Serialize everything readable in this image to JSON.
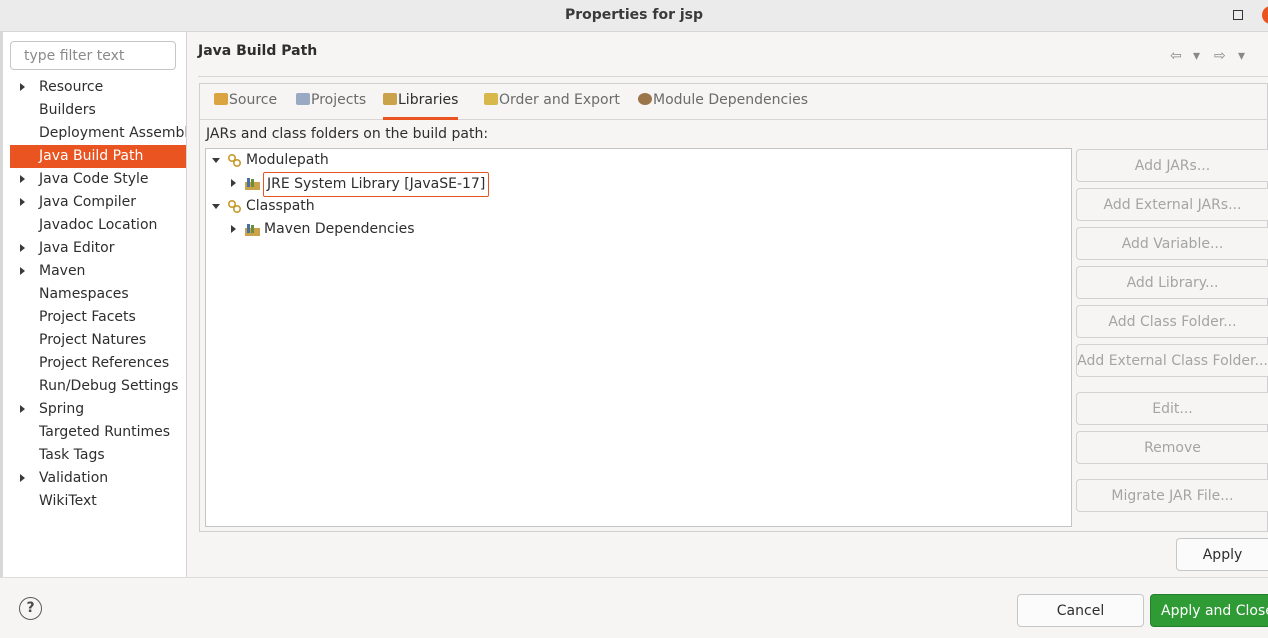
{
  "window": {
    "title": "Properties for jsp"
  },
  "sidebar": {
    "filter_placeholder": "type filter text",
    "items": [
      {
        "label": "Resource",
        "expandable": true
      },
      {
        "label": "Builders",
        "expandable": false
      },
      {
        "label": "Deployment Assembly",
        "expandable": false
      },
      {
        "label": "Java Build Path",
        "expandable": false,
        "selected": true
      },
      {
        "label": "Java Code Style",
        "expandable": true
      },
      {
        "label": "Java Compiler",
        "expandable": true
      },
      {
        "label": "Javadoc Location",
        "expandable": false
      },
      {
        "label": "Java Editor",
        "expandable": true
      },
      {
        "label": "Maven",
        "expandable": true
      },
      {
        "label": "Namespaces",
        "expandable": false
      },
      {
        "label": "Project Facets",
        "expandable": false
      },
      {
        "label": "Project Natures",
        "expandable": false
      },
      {
        "label": "Project References",
        "expandable": false
      },
      {
        "label": "Run/Debug Settings",
        "expandable": false
      },
      {
        "label": "Spring",
        "expandable": true
      },
      {
        "label": "Targeted Runtimes",
        "expandable": false
      },
      {
        "label": "Task Tags",
        "expandable": false
      },
      {
        "label": "Validation",
        "expandable": true
      },
      {
        "label": "WikiText",
        "expandable": false
      }
    ]
  },
  "page": {
    "title": "Java Build Path",
    "nav": {
      "back": "⇦",
      "forward": "⇨",
      "dropdown": "▾"
    }
  },
  "tabs": [
    {
      "label": "Source",
      "icon": "source-folder-icon",
      "active": false
    },
    {
      "label": "Projects",
      "icon": "projects-folder-icon",
      "active": false
    },
    {
      "label": "Libraries",
      "icon": "libraries-icon",
      "active": true
    },
    {
      "label": "Order and Export",
      "icon": "order-export-icon",
      "active": false
    },
    {
      "label": "Module Dependencies",
      "icon": "module-icon",
      "active": false
    }
  ],
  "libraries": {
    "section_label": "JARs and class folders on the build path:",
    "tree": [
      {
        "label": "Modulepath",
        "icon": "classpath-container-icon",
        "expanded": true,
        "children": [
          {
            "label": "JRE System Library [JavaSE-17]",
            "icon": "library-icon",
            "expanded": false
          }
        ]
      },
      {
        "label": "Classpath",
        "icon": "classpath-container-icon",
        "expanded": true,
        "children": [
          {
            "label": "Maven Dependencies",
            "icon": "library-icon",
            "expanded": false
          }
        ]
      }
    ]
  },
  "side_buttons": {
    "add_jars": "Add JARs...",
    "add_external_jars": "Add External JARs...",
    "add_variable": "Add Variable...",
    "add_library": "Add Library...",
    "add_class_folder": "Add Class Folder...",
    "add_external_class_folder": "Add External Class Folder...",
    "edit": "Edit...",
    "remove": "Remove",
    "migrate_jar": "Migrate JAR File..."
  },
  "footer": {
    "apply": "Apply",
    "help": "?",
    "cancel": "Cancel",
    "apply_and_close": "Apply and Close"
  },
  "colors": {
    "accent": "#e95420",
    "primary_button": "#2e9b35",
    "disabled_text": "#a4a4a4"
  }
}
